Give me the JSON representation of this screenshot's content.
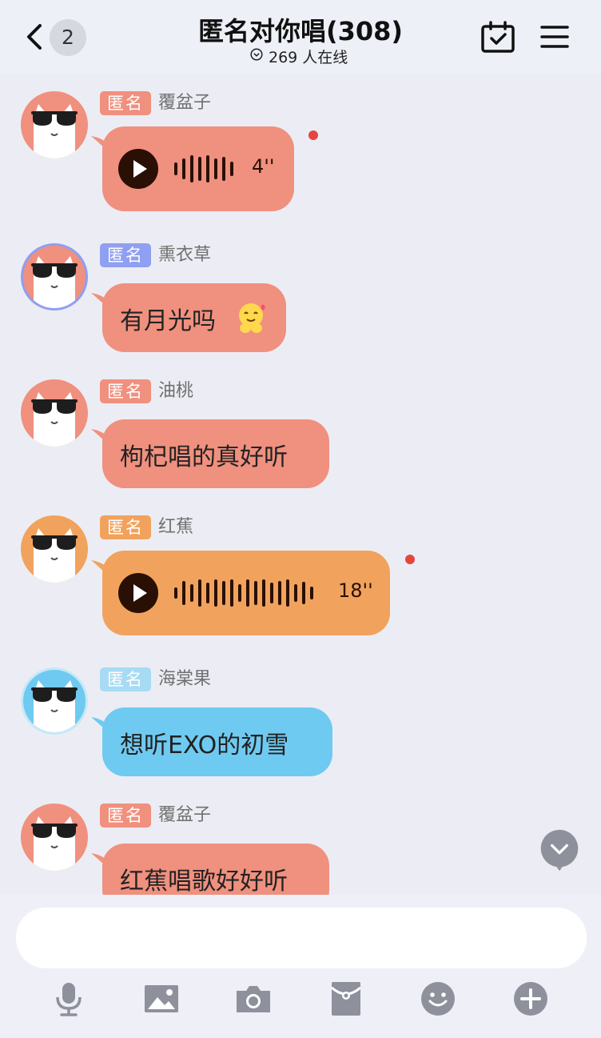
{
  "header": {
    "unread_count": "2",
    "title": "匿名对你唱(308)",
    "online_text": "269 人在线"
  },
  "colors": {
    "red": "#f0907e",
    "lavender_blue": "#8f9ff2",
    "orange": "#f1a35d",
    "sky_blue": "#6fcaf1",
    "voice_dark": "#2a0f05"
  },
  "messages": [
    {
      "tag": "匿名",
      "name": "覆盆子",
      "type": "voice",
      "duration": "4''",
      "unread": true
    },
    {
      "tag": "匿名",
      "name": "熏衣草",
      "type": "text",
      "text": "有月光吗",
      "emoji": "face-with-hearts-icon"
    },
    {
      "tag": "匿名",
      "name": "油桃",
      "type": "text",
      "text": "枸杞唱的真好听"
    },
    {
      "tag": "匿名",
      "name": "红蕉",
      "type": "voice",
      "duration": "18''",
      "unread": true
    },
    {
      "tag": "匿名",
      "name": "海棠果",
      "type": "text",
      "text": "想听EXO的初雪"
    },
    {
      "tag": "匿名",
      "name": "覆盆子",
      "type": "text",
      "text": "红蕉唱歌好好听"
    }
  ],
  "composer": {
    "input_value": "",
    "tools": [
      "microphone-icon",
      "image-icon",
      "camera-icon",
      "red-packet-icon",
      "emoji-icon",
      "plus-icon"
    ]
  }
}
